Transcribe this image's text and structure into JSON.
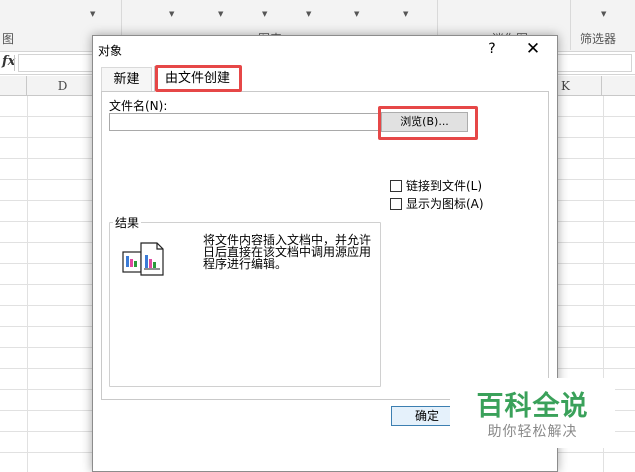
{
  "ribbon": {
    "top_labels": [
      "",
      "",
      "",
      "",
      "",
      "",
      "",
      ""
    ],
    "groups": [
      "图",
      "图表",
      "迷你图",
      "筛选器"
    ]
  },
  "formula_bar": {
    "fx": "fx"
  },
  "columns": [
    "D",
    "K"
  ],
  "dialog": {
    "title": "对象",
    "help": "?",
    "close": "✕",
    "tabs": [
      "新建",
      "由文件创建"
    ],
    "file_name_label": "文件名(N):",
    "file_name_value": "",
    "browse_label": "浏览(B)...",
    "checkboxes": [
      {
        "label": "链接到文件(L)",
        "checked": false
      },
      {
        "label": "显示为图标(A)",
        "checked": false
      }
    ],
    "result_title": "结果",
    "result_text": "将文件内容插入文档中，并允许日后直接在该文档中调用源应用程序进行编辑。",
    "ok_label": "确定"
  },
  "highlight_color": "#e64747",
  "watermark": {
    "main": "百科全说",
    "sub": "助你轻松解决",
    "color": "#3aa15a"
  }
}
